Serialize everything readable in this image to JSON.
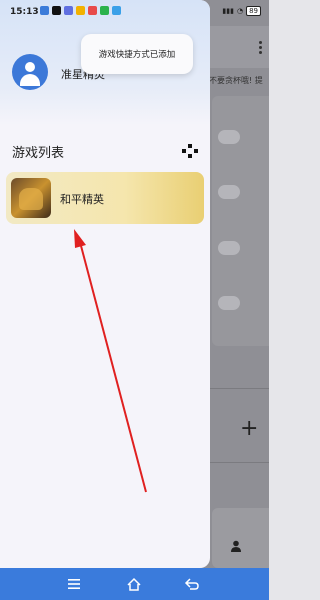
{
  "status_bar": {
    "time": "15:13",
    "battery": "89"
  },
  "toast": {
    "message": "游戏快捷方式已添加"
  },
  "drawer": {
    "username": "准星精灵",
    "section_title": "游戏列表",
    "games": [
      {
        "name": "和平精英"
      }
    ]
  },
  "background": {
    "hint": "不要贪杯哦! 提",
    "plus_symbol": "+"
  },
  "colors": {
    "accent": "#3a7bdc",
    "arrow": "#e02020",
    "game_card": "#f2dc8c"
  },
  "icons": [
    "user-icon",
    "gamepad-icon",
    "menu-icon",
    "home-icon",
    "back-icon",
    "more-icon",
    "person-icon"
  ]
}
